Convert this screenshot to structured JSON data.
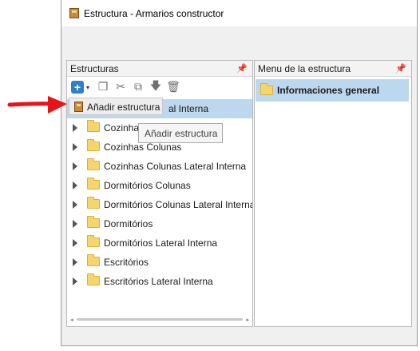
{
  "window": {
    "title": "Estructura - Armarios constructor"
  },
  "left_panel": {
    "title": "Estructuras",
    "pin": "📌",
    "first_row_visible_text": "al Interna",
    "items": [
      "Cozinhas",
      "Cozinhas Colunas",
      "Cozinhas Colunas Lateral Interna",
      "Dormitórios Colunas",
      "Dormitórios Colunas Lateral Interna",
      "Dormitórios",
      "Dormitórios Lateral Interna",
      "Escritórios",
      "Escritórios Lateral Interna"
    ]
  },
  "right_panel": {
    "title": "Menu de la estructura",
    "pin": "📌",
    "items": [
      "Informaciones general"
    ]
  },
  "toolbar": {
    "add_label": "+",
    "dropdown_arrow": "▾",
    "copy_icon": "❐",
    "cut_icon": "✂",
    "paste_icon": "⧉",
    "down_icon": "🡇",
    "delete_icon": "🗑"
  },
  "popup_menu": {
    "label": "Añadir estructura"
  },
  "tooltip": {
    "label": "Añadir estructura"
  },
  "scroll": {
    "left": "◂",
    "right": "▸"
  },
  "colors": {
    "selection": "#bcd8ee",
    "accent": "#2f7fc4",
    "arrow": "#e8141c"
  }
}
